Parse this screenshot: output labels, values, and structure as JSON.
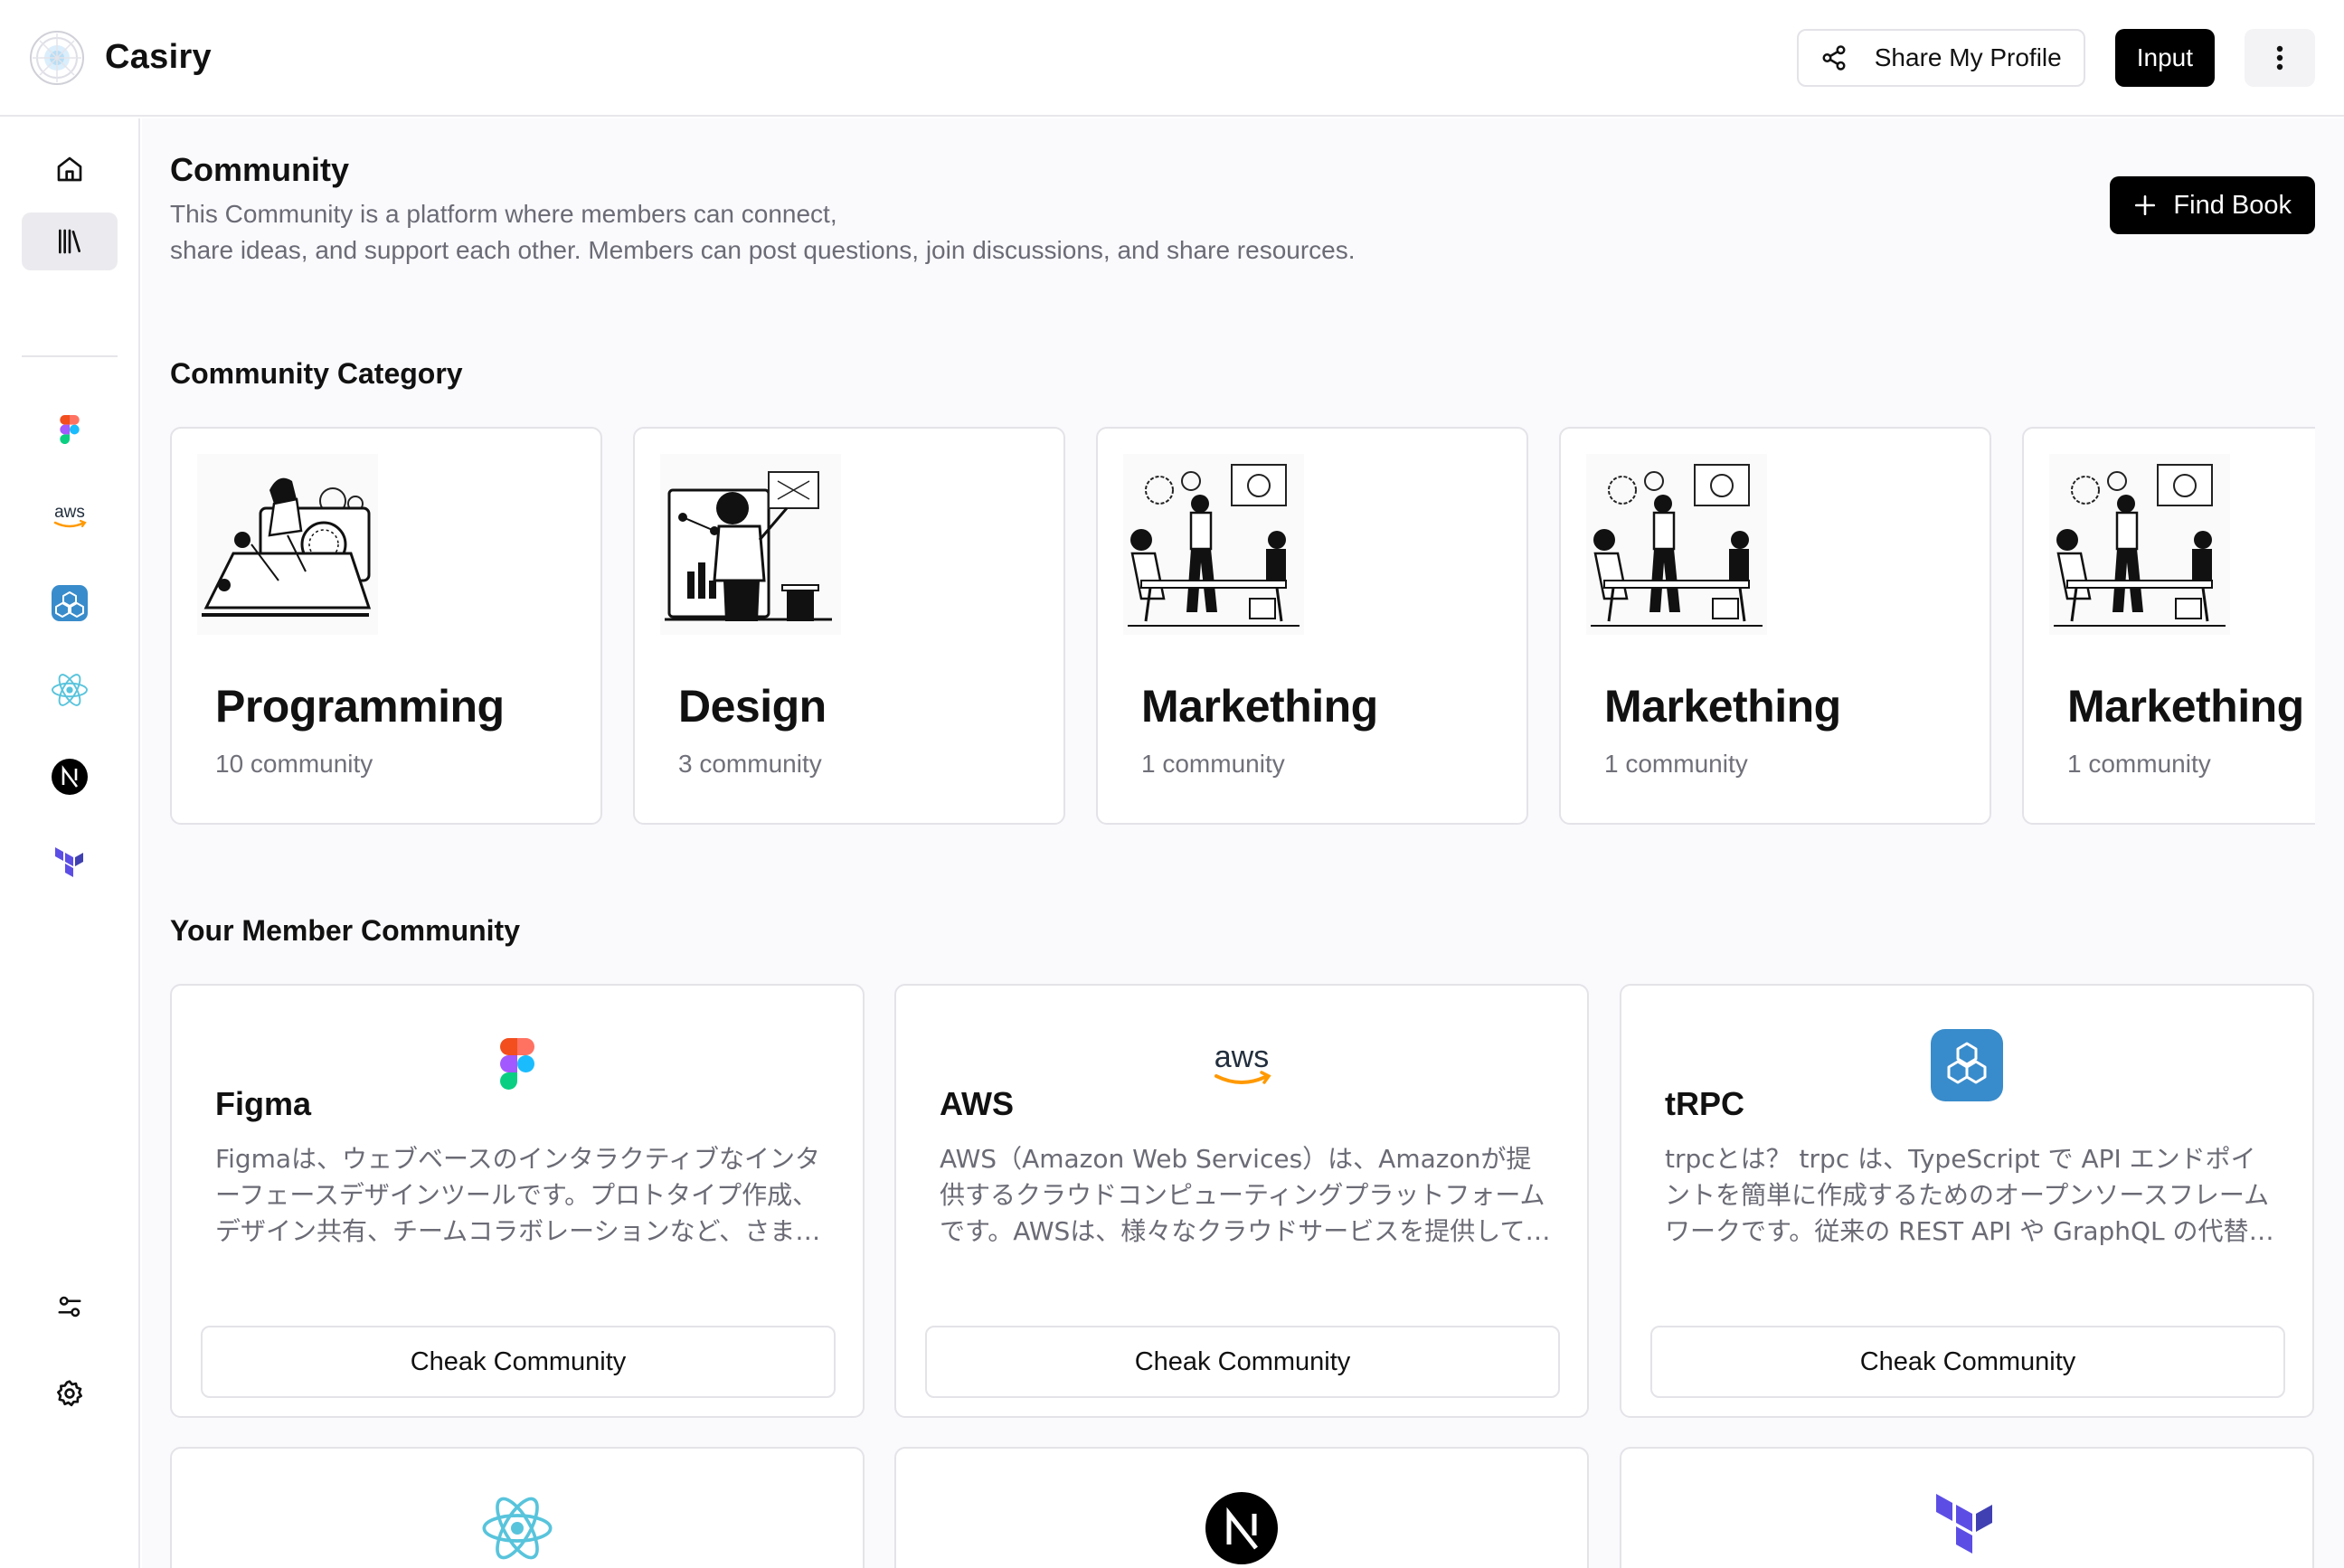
{
  "app": {
    "name": "Casiry"
  },
  "header": {
    "share_label": "Share My Profile",
    "input_label": "Input"
  },
  "sidebar": {
    "items": [
      {
        "icon": "home-icon"
      },
      {
        "icon": "library-icon",
        "active": true
      },
      {
        "icon": "figma-icon"
      },
      {
        "icon": "aws-icon"
      },
      {
        "icon": "trpc-icon"
      },
      {
        "icon": "react-icon"
      },
      {
        "icon": "nextjs-icon"
      },
      {
        "icon": "terraform-icon"
      }
    ],
    "bottom": [
      {
        "icon": "sliders-icon"
      },
      {
        "icon": "gear-icon"
      }
    ]
  },
  "page": {
    "title": "Community",
    "description_line1": "This Community is a platform where members can connect,",
    "description_line2": "share ideas, and support each other. Members can post questions, join discussions, and share resources.",
    "find_label": "Find Book"
  },
  "categories": {
    "title": "Community Category",
    "items": [
      {
        "name": "Programming",
        "count": "10 community"
      },
      {
        "name": "Design",
        "count": "3 community"
      },
      {
        "name": "Markething",
        "count": "1 community"
      },
      {
        "name": "Markething",
        "count": "1 community"
      },
      {
        "name": "Markething",
        "count": "1 community"
      }
    ]
  },
  "members": {
    "title": "Your Member Community",
    "button_label": "Cheak Community",
    "items": [
      {
        "name": "Figma",
        "icon": "figma-icon",
        "description": "Figmaは、ウェブベースのインタラクティブなインターフェースデザインツールです。プロトタイプ作成、デザイン共有、チームコラボレーションなど、さまざまな機能を提供します。"
      },
      {
        "name": "AWS",
        "icon": "aws-icon",
        "description": "AWS（Amazon Web Services）は、Amazonが提供するクラウドコンピューティングプラットフォームです。AWSは、様々なクラウドサービスを提供しています。"
      },
      {
        "name": "tRPC",
        "icon": "trpc-icon",
        "description": "trpcとは？ trpc は、TypeScript で API エンドポイントを簡単に作成するためのオープンソースフレームワークです。従来の REST API や GraphQL の代替えとして使われています。"
      }
    ],
    "partial_items": [
      {
        "icon": "react-icon"
      },
      {
        "icon": "nextjs-icon"
      },
      {
        "icon": "terraform-icon"
      }
    ]
  },
  "colors": {
    "primary": "#000000",
    "background": "#fafafd",
    "border": "#e3e3e8",
    "muted_text": "#6b6b76",
    "trpc_blue": "#398ccb",
    "react_cyan": "#58c4dc",
    "terraform_purple": "#5c4ee5"
  }
}
